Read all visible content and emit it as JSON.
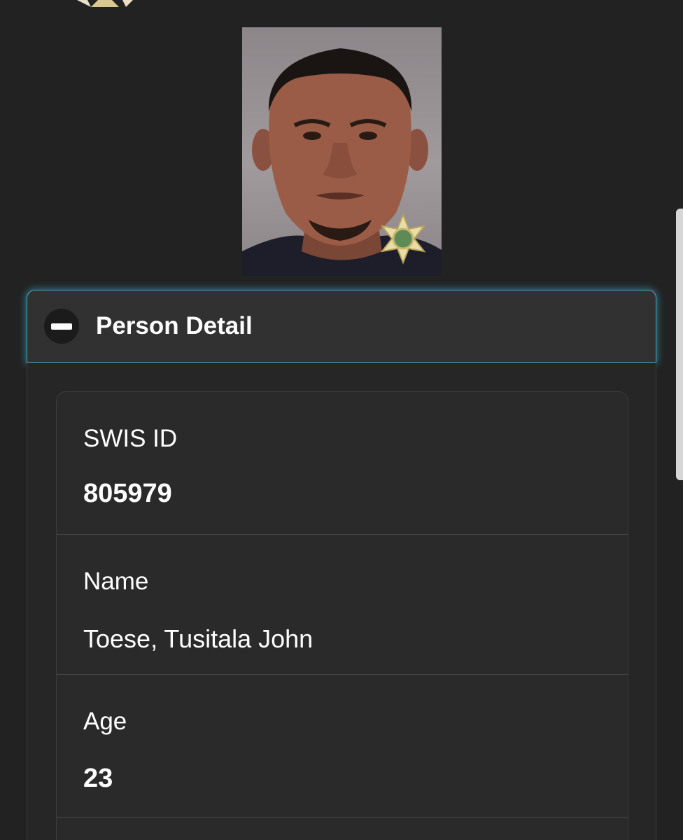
{
  "header": {
    "logo_icon": "sheriff-star-badge-icon"
  },
  "photo": {
    "alt": "booking photo",
    "badge_icon": "sheriff-star-badge-icon"
  },
  "section": {
    "title": "Person Detail",
    "toggle_icon": "minus-icon",
    "accent_color": "#3fa9c6"
  },
  "fields": [
    {
      "label": "SWIS ID",
      "value": "805979"
    },
    {
      "label": "Name",
      "value": "Toese, Tusitala John"
    },
    {
      "label": "Age",
      "value": "23"
    }
  ]
}
